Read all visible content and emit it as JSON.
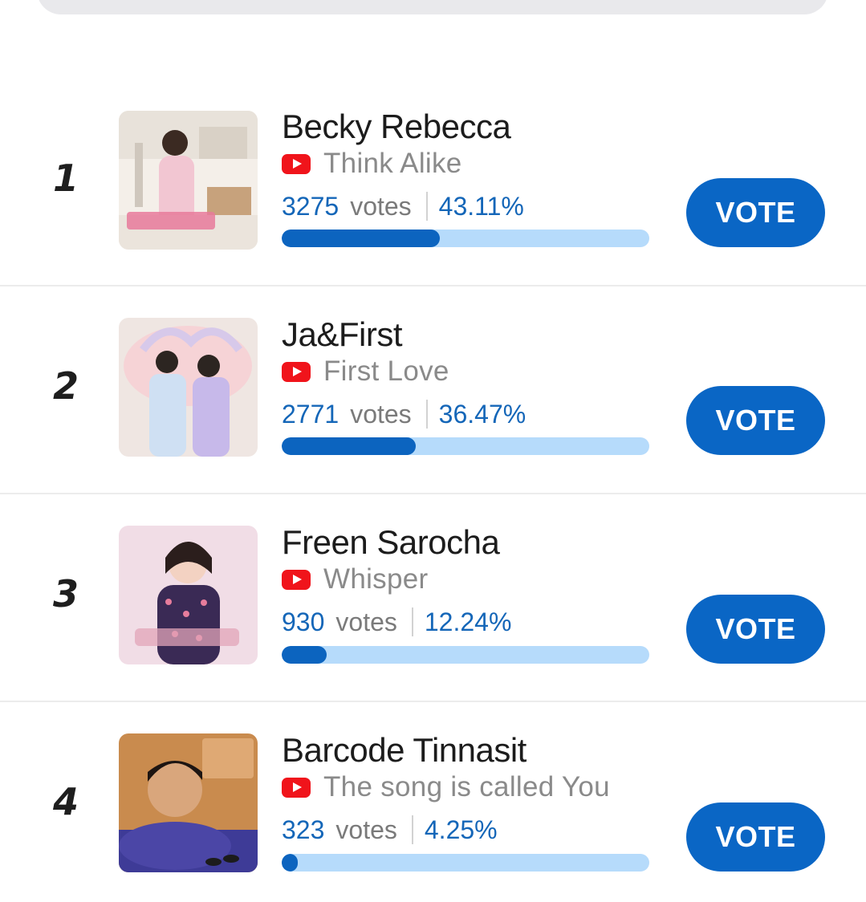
{
  "vote_button_label": "VOTE",
  "votes_word": "votes",
  "colors": {
    "accent": "#0a66c5",
    "bar_track": "#b6dbfb",
    "bar_fill": "#0c64bf",
    "youtube_red": "#f0141b"
  },
  "entries": [
    {
      "rank": "1",
      "name": "Becky Rebecca",
      "song": "Think Alike",
      "votes": "3275",
      "percent": "43.11%",
      "share": 0.4311,
      "thumbnail_icon": "album-cover-think-alike"
    },
    {
      "rank": "2",
      "name": "Ja&First",
      "song": "First Love",
      "votes": "2771",
      "percent": "36.47%",
      "share": 0.3647,
      "thumbnail_icon": "album-cover-first-love"
    },
    {
      "rank": "3",
      "name": "Freen Sarocha",
      "song": "Whisper",
      "votes": "930",
      "percent": "12.24%",
      "share": 0.1224,
      "thumbnail_icon": "album-cover-whisper"
    },
    {
      "rank": "4",
      "name": "Barcode Tinnasit",
      "song": "The song is called You",
      "votes": "323",
      "percent": "4.25%",
      "share": 0.0425,
      "thumbnail_icon": "album-cover-the-song-is-called-you"
    }
  ]
}
